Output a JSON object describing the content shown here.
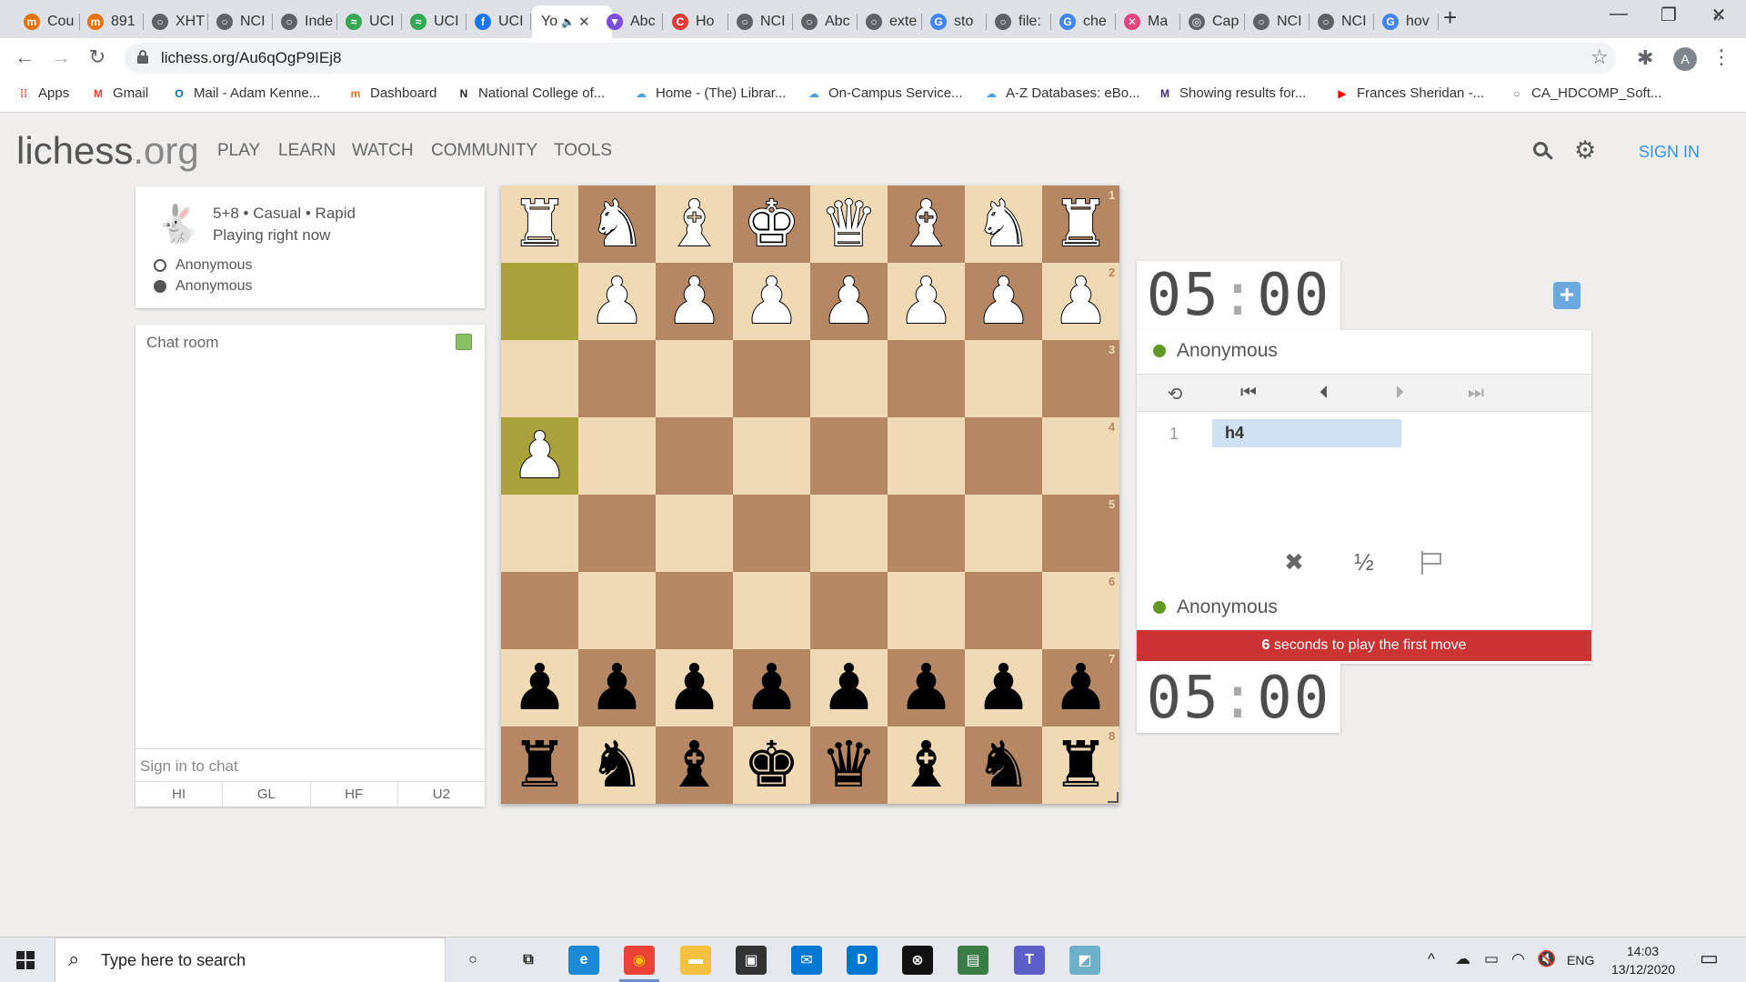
{
  "browser": {
    "tabs": [
      {
        "label": "Cou",
        "color": "#e8710a",
        "glyph": "m"
      },
      {
        "label": "891",
        "color": "#e8710a",
        "glyph": "m"
      },
      {
        "label": "XHT",
        "color": "#5f6368",
        "glyph": "○"
      },
      {
        "label": "NCI",
        "color": "#5f6368",
        "glyph": "○"
      },
      {
        "label": "Inde",
        "color": "#5f6368",
        "glyph": "○"
      },
      {
        "label": "UCI",
        "color": "#34a853",
        "glyph": "≈"
      },
      {
        "label": "UCI",
        "color": "#34a853",
        "glyph": "≈"
      },
      {
        "label": "UCI",
        "color": "#1877f2",
        "glyph": "f"
      },
      {
        "label": "Yo",
        "color": "#ffffff",
        "glyph": "",
        "active": true,
        "mute": "🔈",
        "close": "✕"
      },
      {
        "label": "Abc",
        "color": "#7b4ee0",
        "glyph": "▼"
      },
      {
        "label": "Ho",
        "color": "#e53935",
        "glyph": "C"
      },
      {
        "label": "NCI",
        "color": "#5f6368",
        "glyph": "○"
      },
      {
        "label": "Abc",
        "color": "#5f6368",
        "glyph": "○"
      },
      {
        "label": "exte",
        "color": "#5f6368",
        "glyph": "○"
      },
      {
        "label": "sto",
        "color": "#4285f4",
        "glyph": "G"
      },
      {
        "label": "file:",
        "color": "#5f6368",
        "glyph": "○"
      },
      {
        "label": "che",
        "color": "#4285f4",
        "glyph": "G"
      },
      {
        "label": "Ma",
        "color": "#e0457b",
        "glyph": "✕"
      },
      {
        "label": "Cap",
        "color": "#5f6368",
        "glyph": "◎"
      },
      {
        "label": "NCI",
        "color": "#5f6368",
        "glyph": "○"
      },
      {
        "label": "NCI",
        "color": "#5f6368",
        "glyph": "○"
      },
      {
        "label": "hov",
        "color": "#4285f4",
        "glyph": "G"
      }
    ],
    "new_tab": "+",
    "window_controls": {
      "minimize": "—",
      "maximize": "❐",
      "close": "✕"
    },
    "nav": {
      "back": "←",
      "forward": "→",
      "reload": "↻"
    },
    "url": "lichess.org/Au6qOgP9IEj8",
    "star": "☆",
    "extensions": "✱",
    "profile_initial": "A",
    "menu": "⋮",
    "bookmarks": [
      {
        "label": "Apps",
        "glyph": "⁞⁞",
        "color": "#ea4335"
      },
      {
        "label": "Gmail",
        "glyph": "M",
        "color": "#ea4335"
      },
      {
        "label": "Mail - Adam Kenne...",
        "glyph": "O",
        "color": "#0a66c2"
      },
      {
        "label": "Dashboard",
        "glyph": "m",
        "color": "#e8710a"
      },
      {
        "label": "National College of...",
        "glyph": "N",
        "color": "#222222"
      },
      {
        "label": "Home - (The) Librar...",
        "glyph": "☁",
        "color": "#4aa3df"
      },
      {
        "label": "On-Campus Service...",
        "glyph": "☁",
        "color": "#4aa3df"
      },
      {
        "label": "A-Z Databases: eBo...",
        "glyph": "☁",
        "color": "#4aa3df"
      },
      {
        "label": "Showing results for...",
        "glyph": "M",
        "color": "#3b2a70"
      },
      {
        "label": "Frances Sheridan -...",
        "glyph": "▶",
        "color": "#ff0000"
      },
      {
        "label": "CA_HDCOMP_Soft...",
        "glyph": "○",
        "color": "#5f6368"
      }
    ],
    "bookmarks_more": "»"
  },
  "site": {
    "logo_main": "lichess",
    "logo_tld": ".org",
    "nav": [
      "PLAY",
      "LEARN",
      "WATCH",
      "COMMUNITY",
      "TOOLS"
    ],
    "gear": "⚙",
    "sign_in": "SIGN IN"
  },
  "game": {
    "rabbit": "🐇",
    "setup": "5+8 • Casual • Rapid",
    "status": "Playing right now",
    "players": [
      "Anonymous",
      "Anonymous"
    ]
  },
  "chat": {
    "title": "Chat room",
    "input_placeholder": "Sign in to chat",
    "presets": [
      "HI",
      "GL",
      "HF",
      "U2"
    ]
  },
  "board": {
    "orientation": "black",
    "colors": {
      "light": "#f0d9b5",
      "dark": "#b58863",
      "highlight_light": "#cdd26a",
      "highlight_dark": "#aaa23a"
    },
    "last_move": [
      "h2",
      "h4"
    ],
    "position": {
      "a1": "wR",
      "b1": "wN",
      "c1": "wB",
      "d1": "wQ",
      "e1": "wK",
      "f1": "wB",
      "g1": "wN",
      "h1": "wR",
      "a2": "wP",
      "b2": "wP",
      "c2": "wP",
      "d2": "wP",
      "e2": "wP",
      "f2": "wP",
      "g2": "wP",
      "h4": "wP",
      "a7": "bP",
      "b7": "bP",
      "c7": "bP",
      "d7": "bP",
      "e7": "bP",
      "f7": "bP",
      "g7": "bP",
      "h7": "bP",
      "a8": "bR",
      "b8": "bN",
      "c8": "bB",
      "d8": "bQ",
      "e8": "bK",
      "f8": "bB",
      "g8": "bN",
      "h8": "bR"
    }
  },
  "clocks": {
    "top": {
      "min": "05",
      "sep": ":",
      "sec": "00"
    },
    "bottom": {
      "min": "05",
      "sep": ":",
      "sec": "00"
    }
  },
  "panel": {
    "add_time": "+",
    "top_player": "Anonymous",
    "bottom_player": "Anonymous",
    "controls": {
      "flip": "⟲",
      "first": "⏮",
      "prev": "⏴",
      "next": "⏵",
      "last": "⏭"
    },
    "moves": [
      {
        "index": "1",
        "white": "h4"
      }
    ],
    "game_controls": {
      "abort": "✖",
      "draw": "½"
    },
    "warning_seconds": "6",
    "warning_text": " seconds to play the first move"
  },
  "taskbar": {
    "search_placeholder": "Type here to search",
    "apps": [
      {
        "name": "cortana",
        "glyph": "○",
        "color": "#e5e8ec",
        "fg": "#222222"
      },
      {
        "name": "task-view",
        "glyph": "⧉",
        "color": "#e5e8ec",
        "fg": "#222222"
      },
      {
        "name": "edge",
        "glyph": "e",
        "color": "#1b8ad6",
        "fg": "#ffffff"
      },
      {
        "name": "chrome",
        "glyph": "◉",
        "color": "#ea4335",
        "fg": "#fbbc05",
        "running": true
      },
      {
        "name": "file-explorer",
        "glyph": "▬",
        "color": "#f5c142",
        "fg": "#ffffff"
      },
      {
        "name": "store",
        "glyph": "▣",
        "color": "#333333",
        "fg": "#ffffff"
      },
      {
        "name": "mail",
        "glyph": "✉",
        "color": "#0078d4",
        "fg": "#ffffff"
      },
      {
        "name": "dell",
        "glyph": "D",
        "color": "#0076ce",
        "fg": "#ffffff"
      },
      {
        "name": "xbox",
        "glyph": "⊗",
        "color": "#111111",
        "fg": "#ffffff"
      },
      {
        "name": "sway",
        "glyph": "▤",
        "color": "#3a7d44",
        "fg": "#ffffff"
      },
      {
        "name": "teams",
        "glyph": "T",
        "color": "#5b5fc7",
        "fg": "#ffffff"
      },
      {
        "name": "snip",
        "glyph": "◩",
        "color": "#6fb0c9",
        "fg": "#ffffff"
      }
    ],
    "tray": {
      "chevron": "^",
      "cloud": "☁",
      "battery": "▭",
      "wifi": "◠",
      "volume": "🔇",
      "lang": "ENG"
    },
    "time": "14:03",
    "date": "13/12/2020",
    "notifications": "▭"
  }
}
